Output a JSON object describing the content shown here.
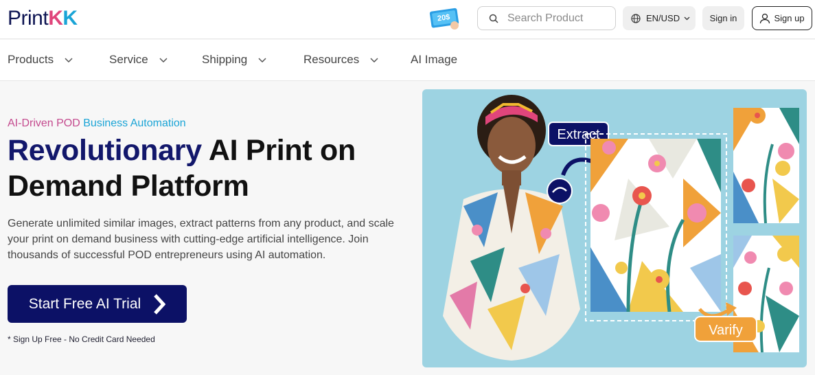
{
  "header": {
    "logo_text": "Print",
    "logo_k1": "K",
    "logo_k2": "K",
    "coupon_text": "20$",
    "search_placeholder": "Search Product",
    "lang_label": "EN/USD",
    "signin_label": "Sign in",
    "signup_label": "Sign up"
  },
  "nav": {
    "items": [
      {
        "label": "Products"
      },
      {
        "label": "Service"
      },
      {
        "label": "Shipping"
      },
      {
        "label": "Resources"
      },
      {
        "label": "AI Image"
      }
    ]
  },
  "hero": {
    "tagline_ai": "AI-Driven POD",
    "tagline_rest": " Business Automation",
    "title_highlight": "Revolutionary",
    "title_rest": " AI Print on Demand Platform",
    "description": "Generate unlimited similar images, extract patterns from any product, and scale your print on demand business with cutting-edge artificial intelligence. Join thousands of successful POD entrepreneurs using AI automation.",
    "cta_label": "Start Free AI Trial",
    "note": "* Sign Up Free - No Credit Card Needed"
  },
  "visual": {
    "extract_label": "Extract",
    "verify_label": "Varify"
  },
  "colors": {
    "brand_navy": "#0c1166",
    "accent_pink": "#e0457b",
    "accent_blue": "#1aa4d6",
    "panel_bg": "#9dd3e2"
  }
}
